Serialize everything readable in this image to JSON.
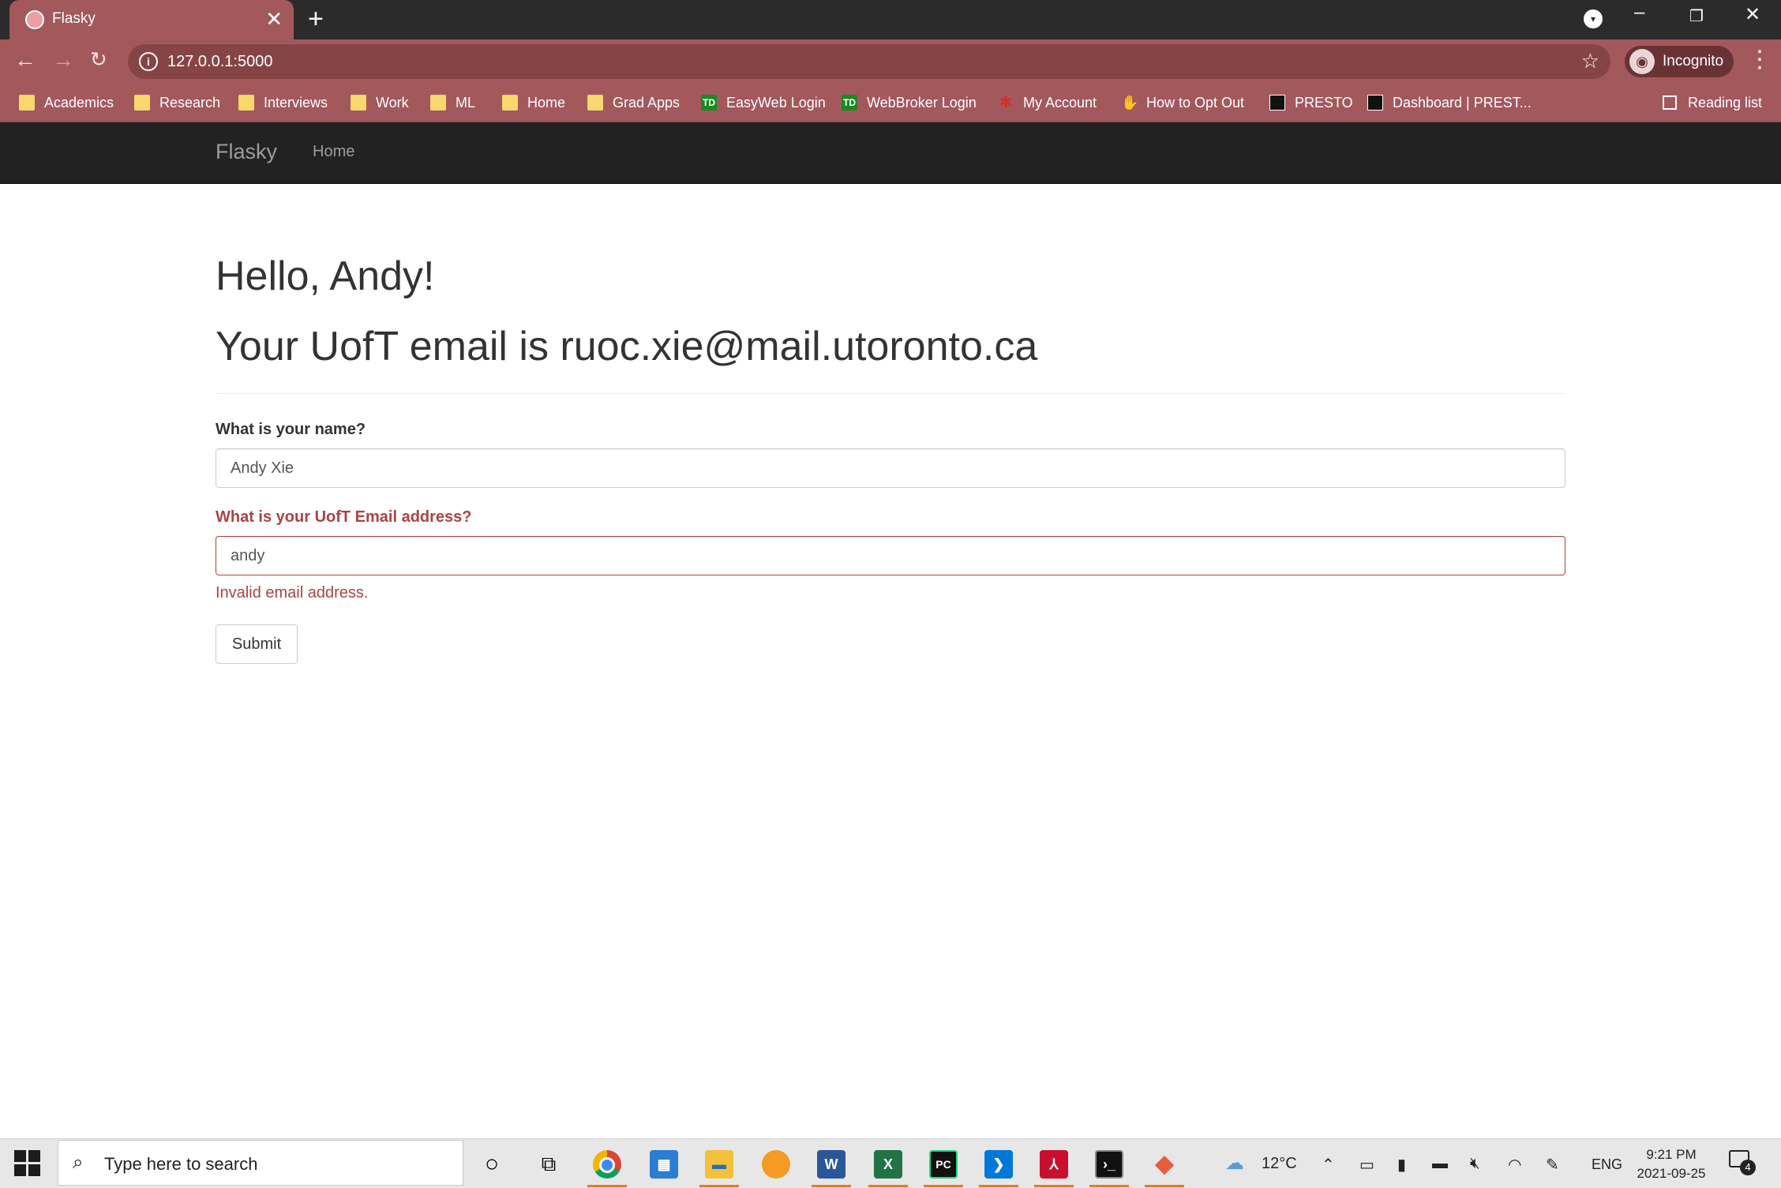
{
  "browser": {
    "tab_title": "Flasky",
    "tab_close": "✕",
    "new_tab": "+",
    "url": "127.0.0.1:5000",
    "profile_label": "Incognito",
    "info_glyph": "i"
  },
  "bookmarks": [
    {
      "label": "Academics",
      "icon": "folder-icon"
    },
    {
      "label": "Research",
      "icon": "folder-icon"
    },
    {
      "label": "Interviews",
      "icon": "folder-icon"
    },
    {
      "label": "Work",
      "icon": "folder-icon"
    },
    {
      "label": "ML",
      "icon": "folder-icon"
    },
    {
      "label": "Home",
      "icon": "folder-icon"
    },
    {
      "label": "Grad Apps",
      "icon": "folder-icon"
    },
    {
      "label": "EasyWeb Login",
      "icon": "td-bank-icon"
    },
    {
      "label": "WebBroker Login",
      "icon": "td-bank-icon"
    },
    {
      "label": "My Account",
      "icon": "maple-leaf-icon"
    },
    {
      "label": "How to Opt Out",
      "icon": "hand-icon"
    },
    {
      "label": "PRESTO",
      "icon": "presto-icon"
    },
    {
      "label": "Dashboard | PREST...",
      "icon": "presto-icon"
    }
  ],
  "reading_list": "Reading list",
  "td_glyph": "TD",
  "navbar": {
    "brand": "Flasky",
    "link_home": "Home"
  },
  "page": {
    "greeting": "Hello, Andy!",
    "email_line": "Your UofT email is ruoc.xie@mail.utoronto.ca",
    "form": {
      "name_label": "What is your name?",
      "name_value": "Andy Xie",
      "email_label": "What is your UofT Email address?",
      "email_value": "andy",
      "email_error": "Invalid email address.",
      "submit_label": "Submit"
    }
  },
  "taskbar": {
    "search_placeholder": "Type here to search",
    "temperature": "12°C",
    "language": "ENG",
    "time": "9:21 PM",
    "date": "2021-09-25",
    "notification_count": "4",
    "app_letters": {
      "word": "W",
      "excel": "X",
      "pycharm": "PC"
    }
  },
  "colors": {
    "accent_error": "#a94442",
    "browser_theme": "#a3585c",
    "navbar": "#222222"
  }
}
